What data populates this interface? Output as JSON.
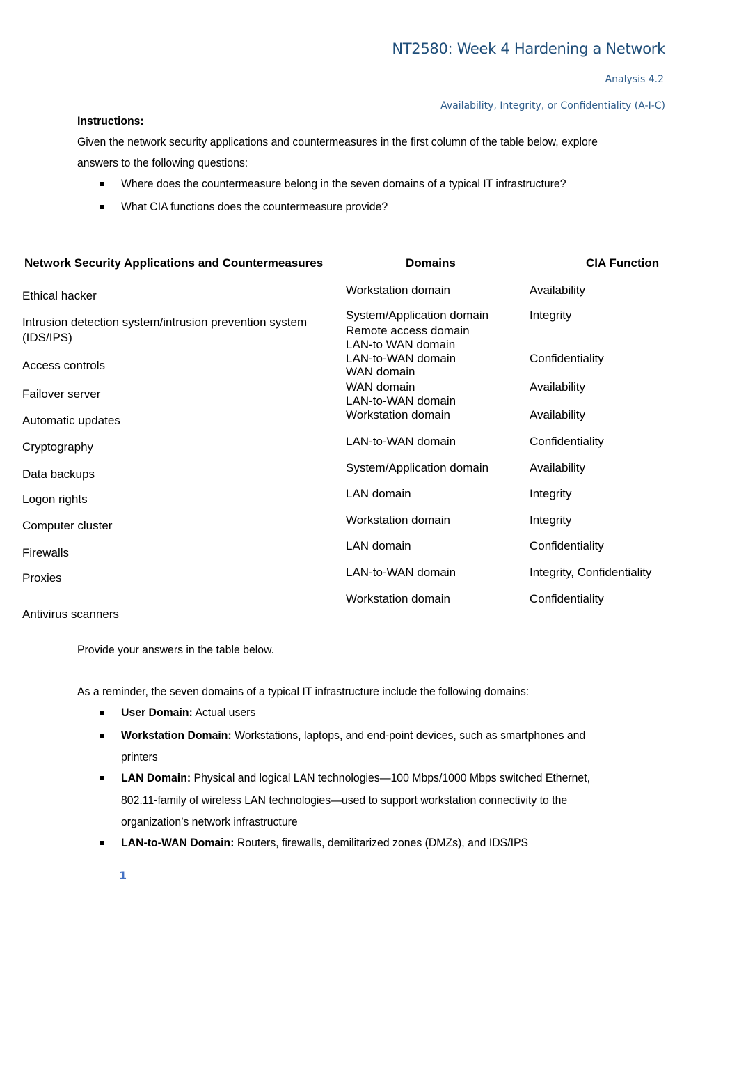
{
  "header": {
    "title": "NT2580: Week 4 Hardening a Network",
    "subtitle": "Analysis 4.2",
    "subtitle2": "Availability, Integrity, or Confidentiality (A-I-C)"
  },
  "instructions": {
    "heading": "Instructions:",
    "line1": "Given the network security applications and countermeasures in the first column of the table below, explore",
    "line2": "answers to the following questions:",
    "questions": [
      "Where does the countermeasure belong in the seven domains of a typical IT infrastructure?",
      "What CIA functions does the countermeasure provide?"
    ]
  },
  "table": {
    "headers": [
      "Network Security Applications and Countermeasures",
      "Domains",
      "CIA Function"
    ],
    "countermeasures": [
      "Ethical hacker",
      "Intrusion detection system/intrusion prevention system",
      "(IDS/IPS)",
      "Access controls",
      "Failover server",
      "Automatic updates",
      "Cryptography",
      "Data backups",
      "Logon rights",
      "Computer cluster",
      "Firewalls",
      "Proxies",
      "Antivirus scanners"
    ],
    "domains": [
      "Workstation domain",
      "System/Application domain",
      "Remote access domain",
      "LAN-to WAN domain",
      "LAN-to-WAN domain",
      "WAN domain",
      "WAN domain",
      "LAN-to-WAN domain",
      "Workstation domain",
      "LAN-to-WAN domain",
      "System/Application domain",
      "LAN domain",
      "Workstation domain",
      "LAN domain",
      "LAN-to-WAN domain",
      "Workstation domain"
    ],
    "cia": [
      "Availability",
      "Integrity",
      "Confidentiality",
      "Availability",
      "Availability",
      "Confidentiality",
      "Availability",
      "Integrity",
      "Integrity",
      "Confidentiality",
      "Integrity, Confidentiality",
      "Confidentiality"
    ]
  },
  "provide_answers": "Provide your answers in the table below.",
  "reminder": {
    "intro": "As a reminder, the seven domains of a typical IT infrastructure include the following domains:",
    "items": [
      {
        "term": "User Domain:",
        "desc": " Actual users"
      },
      {
        "term": "Workstation Domain:",
        "desc": " Workstations, laptops, and end-point devices, such as smartphones and",
        "cont": "printers"
      },
      {
        "term": "LAN Domain:",
        "desc": " Physical and logical LAN technologies—100 Mbps/1000 Mbps switched Ethernet,",
        "cont": "802.11-family of wireless LAN technologies—used to support workstation connectivity to the",
        "cont2": "organization’s network infrastructure"
      },
      {
        "term": "LAN-to-WAN Domain:",
        "desc": " Routers, firewalls, demilitarized zones (DMZs), and IDS/IPS"
      }
    ]
  },
  "page_number": "1"
}
